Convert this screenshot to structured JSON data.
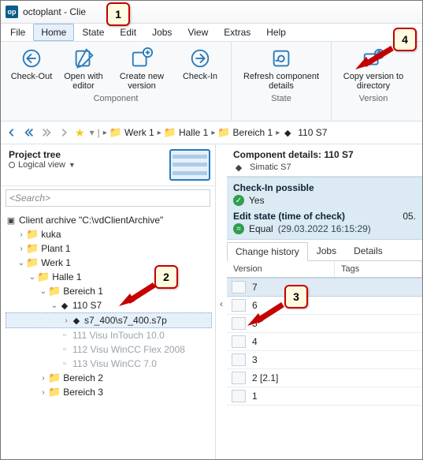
{
  "window": {
    "title": "octoplant - Clie",
    "logo": "op"
  },
  "menubar": {
    "items": [
      "File",
      "Home",
      "State",
      "Edit",
      "Jobs",
      "View",
      "Extras",
      "Help"
    ],
    "selected_index": 1
  },
  "ribbon": {
    "groups": [
      {
        "caption": "Component",
        "buttons": [
          {
            "id": "check-out",
            "label": "Check-Out"
          },
          {
            "id": "open-with-editor",
            "label": "Open with\neditor"
          },
          {
            "id": "create-new-version",
            "label": "Create new\nversion"
          },
          {
            "id": "check-in",
            "label": "Check-In"
          }
        ]
      },
      {
        "caption": "State",
        "buttons": [
          {
            "id": "refresh-component-details",
            "label": "Refresh\ncomponent details"
          }
        ]
      },
      {
        "caption": "Version",
        "buttons": [
          {
            "id": "copy-version-to-directory",
            "label": "Copy version\nto directory"
          }
        ]
      }
    ]
  },
  "breadcrumb": {
    "items": [
      "Werk 1",
      "Halle 1",
      "Bereich 1",
      "110 S7"
    ]
  },
  "project_tree": {
    "title": "Project tree",
    "view_label": "Logical view",
    "search_placeholder": "<Search>",
    "root_label": "Client archive \"C:\\vdClientArchive\"",
    "nodes": [
      {
        "label": "kuka",
        "expandable": true,
        "open": false,
        "depth": 1,
        "folder": true
      },
      {
        "label": "Plant 1",
        "expandable": true,
        "open": false,
        "depth": 1,
        "folder": true
      },
      {
        "label": "Werk 1",
        "expandable": true,
        "open": true,
        "depth": 1,
        "folder": true
      },
      {
        "label": "Halle 1",
        "expandable": true,
        "open": true,
        "depth": 2,
        "folder": true
      },
      {
        "label": "Bereich 1",
        "expandable": true,
        "open": true,
        "depth": 3,
        "folder": true
      },
      {
        "label": "110 S7",
        "expandable": true,
        "open": true,
        "depth": 4,
        "folder": false,
        "comp": true
      },
      {
        "label": "s7_400\\s7_400.s7p",
        "expandable": true,
        "open": false,
        "depth": 5,
        "folder": false,
        "file": true,
        "selected": true
      },
      {
        "label": "111 Visu InTouch 10.0",
        "depth": 4,
        "dim": true
      },
      {
        "label": "112 Visu WinCC Flex 2008",
        "depth": 4,
        "dim": true
      },
      {
        "label": "113 Visu WinCC 7.0",
        "depth": 4,
        "dim": true
      },
      {
        "label": "Bereich 2",
        "expandable": true,
        "open": false,
        "depth": 3,
        "folder": true
      },
      {
        "label": "Bereich 3",
        "expandable": true,
        "open": false,
        "depth": 3,
        "folder": true
      }
    ]
  },
  "component_details": {
    "title": "Component details: 110 S7",
    "subtype": "Simatic S7",
    "checkin_header": "Check-In possible",
    "checkin_value": "Yes",
    "edit_state_header": "Edit state (time of check)",
    "edit_state_value": "Equal",
    "edit_state_time": "(29.03.2022 16:15:29)",
    "edit_state_right": "05.",
    "tabs": [
      "Change history",
      "Jobs",
      "Details"
    ],
    "tabs_selected_index": 0,
    "columns": [
      "Version",
      "Tags"
    ],
    "versions": [
      "7",
      "6",
      "5",
      "4",
      "3",
      "2 [2.1]",
      "1"
    ],
    "selected_version_index": 0
  },
  "callouts": {
    "c1": "1",
    "c2": "2",
    "c3": "3",
    "c4": "4"
  }
}
